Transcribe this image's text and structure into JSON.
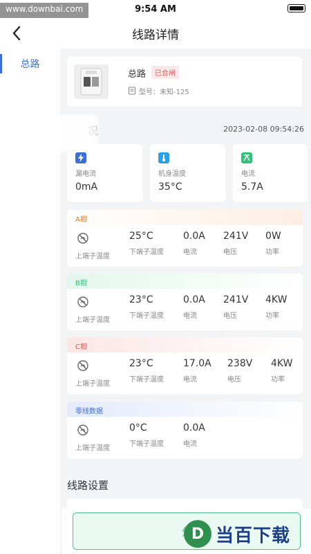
{
  "status_bar": {
    "time": "9:54 AM",
    "watermark": "www.downbai.com"
  },
  "nav": {
    "title": "线路详情"
  },
  "sidebar": {
    "items": [
      {
        "label": "总路"
      }
    ]
  },
  "device": {
    "name": "总路",
    "badge": "已合闸",
    "model": "型号：未知-125"
  },
  "overview": {
    "title": "况",
    "time": "2023-02-08 09:54:26",
    "stats": [
      {
        "label": "漏电流",
        "value": "0mA",
        "icon": "bolt-icon",
        "color": "#3b6fd8"
      },
      {
        "label": "机身温度",
        "value": "35°C",
        "icon": "thermometer-icon",
        "color": "#2aa0e6"
      },
      {
        "label": "电流",
        "value": "5.7A",
        "icon": "current-icon",
        "color": "#2ec27a"
      }
    ]
  },
  "phases": [
    {
      "title": "A相",
      "title_color": "#e07b2a",
      "gradient": "#fdeee2",
      "values": [
        "25°C",
        "0.0A",
        "241V",
        "0W"
      ],
      "labels": [
        "下端子温度",
        "电流",
        "电压",
        "功率"
      ],
      "sub_label": "上端子温度"
    },
    {
      "title": "B相",
      "title_color": "#2ec27a",
      "gradient": "#e4f7ec",
      "values": [
        "23°C",
        "0.0A",
        "241V",
        "4KW"
      ],
      "labels": [
        "下端子温度",
        "电流",
        "电压",
        "功率"
      ],
      "sub_label": "上端子温度"
    },
    {
      "title": "C相",
      "title_color": "#e05555",
      "gradient": "#fce6e6",
      "values": [
        "23°C",
        "17.0A",
        "238V",
        "4KW"
      ],
      "labels": [
        "下端子温度",
        "电流",
        "电压",
        "功率"
      ],
      "sub_label": "上端子温度"
    },
    {
      "title": "零线数据",
      "title_color": "#3b6fd8",
      "gradient": "#e3ebfb",
      "values": [
        "0°C",
        "0.0A"
      ],
      "labels": [
        "下端子温度",
        "电流"
      ],
      "sub_label": "上端子温度"
    }
  ],
  "settings": {
    "title": "线路设置"
  },
  "bottom": {
    "button": "分",
    "logo_letter": "D",
    "logo_text": "当百下载"
  }
}
